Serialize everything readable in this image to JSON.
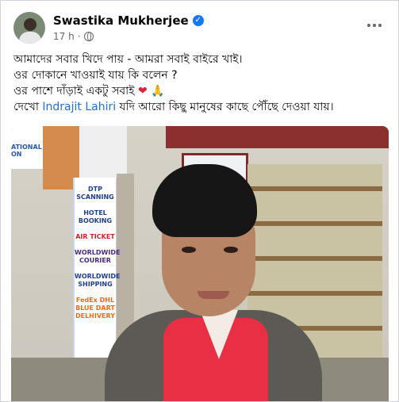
{
  "post": {
    "author_name": "Swastika Mukherjee",
    "time": "17 h",
    "verified_label": "✓",
    "dot": "·"
  },
  "text": {
    "line1": "আমাদের সবার খিদে পায় - আমরা সবাই বাইরে খাই।",
    "line2": "ওর দোকানে খাওয়াই যায় কি বলেন ?",
    "line3_prefix": "ওর পাশে দাঁড়াই একটু সবাই ",
    "line3_heart": "❤",
    "line3_hands": " 🙏",
    "line4_prefix": "দেখো ",
    "line4_mention": "Indrajit Lahiri",
    "line4_suffix": " যদি আরো কিছু মানুষের কাছে পৌঁছে দেওয়া যায়।"
  },
  "photo": {
    "sign_text": "ATIONAL ON",
    "ad_text_1": "DTP SCANNING",
    "ad_text_2": "HOTEL BOOKING",
    "ad_text_3": "AIR TICKET",
    "ad_text_4": "WORLDWIDE COURIER",
    "ad_text_5": "WORLDWIDE SHIPPING",
    "ad_text_6": "FedEx DHL BLUE DART DELHIVERY"
  }
}
